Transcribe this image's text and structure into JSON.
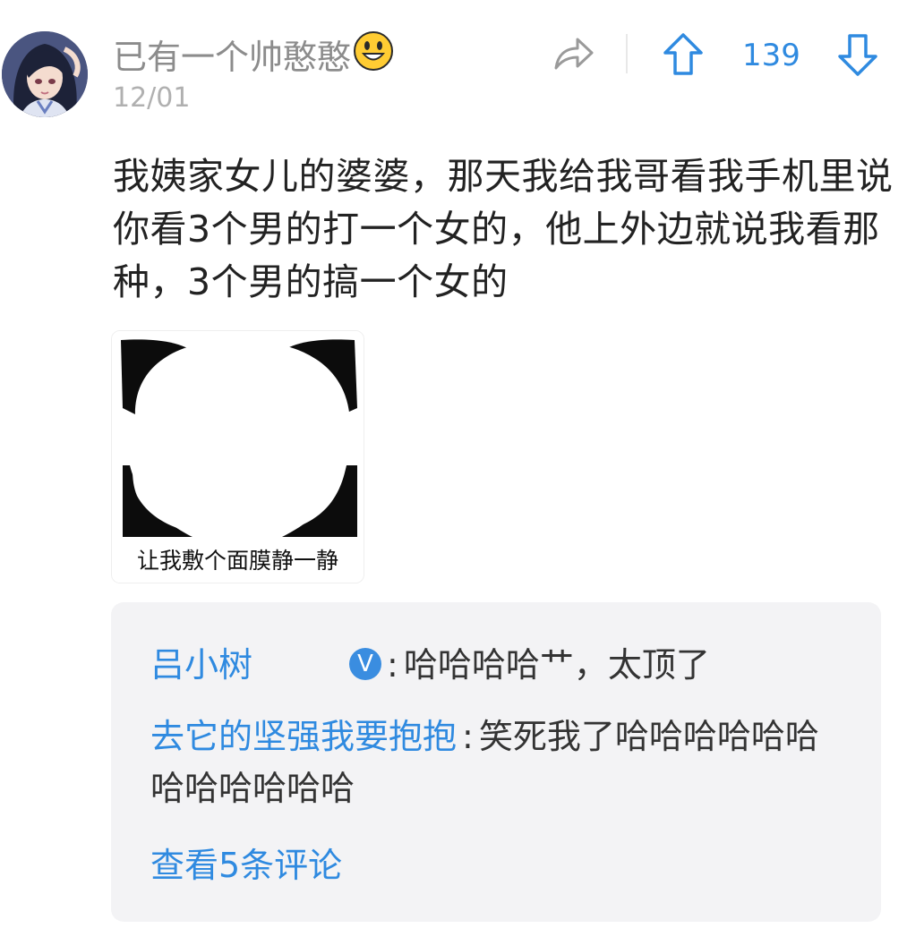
{
  "post": {
    "author": {
      "name": "已有一个帅憨憨",
      "name_emoji": "grinning-face-icon",
      "avatar": "anime-girl-avatar"
    },
    "date": "12/01",
    "actions": {
      "share_icon": "share-arrow-icon",
      "upvote_icon": "up-arrow-icon",
      "downvote_icon": "down-arrow-icon",
      "vote_count": "139"
    },
    "text": "我姨家女儿的婆婆，那天我给我哥看我手机里说你看3个男的打一个女的，他上外边就说我看那种，3个男的搞一个女的",
    "image": {
      "type": "panda-face-meme",
      "caption": "让我敷个面膜静一静"
    }
  },
  "comments": {
    "items": [
      {
        "user": "吕小树",
        "badge": "V",
        "separator": ":",
        "text": "哈哈哈哈艹，太顶了"
      },
      {
        "user": "去它的坚强我要抱抱",
        "separator": ":",
        "text": "笑死我了哈哈哈哈哈哈哈哈哈哈哈哈"
      }
    ],
    "view_more": "查看5条评论"
  },
  "colors": {
    "accent": "#2f8ae0",
    "username": "#8c8c8c",
    "date": "#b0b0b0",
    "body_text": "#222222",
    "comment_bg": "#f3f3f5"
  }
}
